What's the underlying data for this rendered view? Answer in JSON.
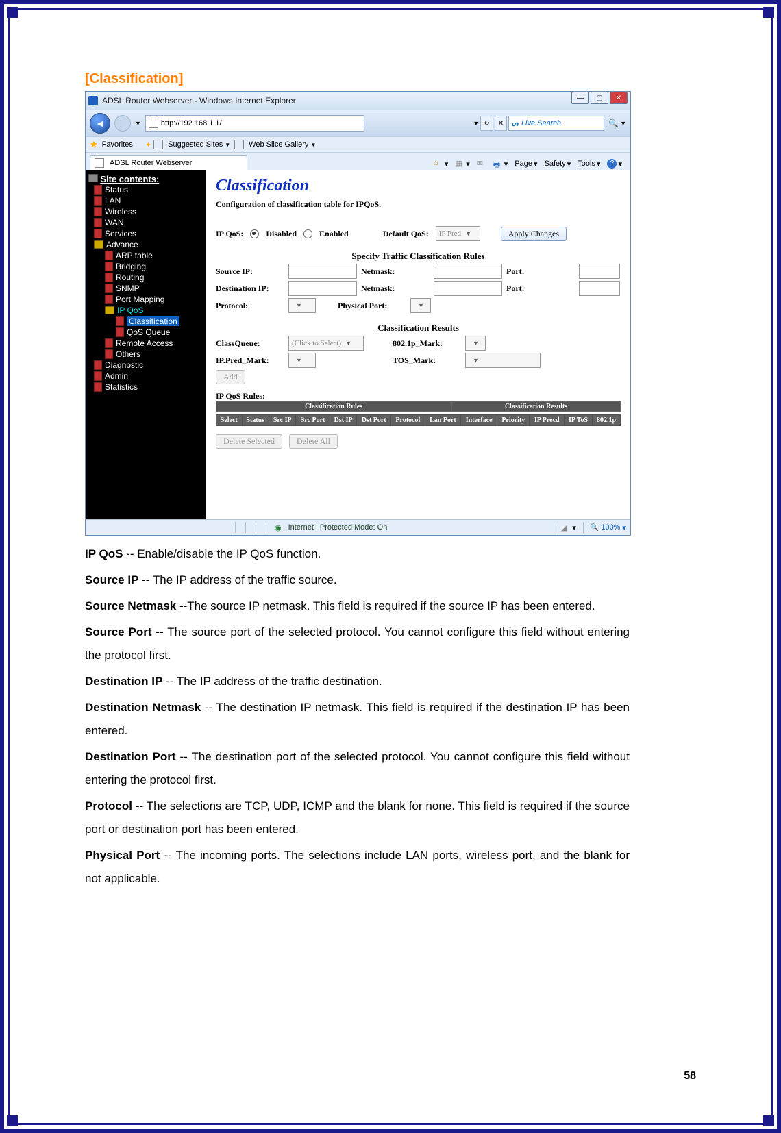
{
  "section_title": "[Classification]",
  "window": {
    "title": "ADSL Router Webserver - Windows Internet Explorer",
    "url": "http://192.168.1.1/",
    "search_placeholder": "Live Search",
    "favorites_label": "Favorites",
    "suggested_label": "Suggested Sites",
    "webslice_label": "Web Slice Gallery",
    "tab_label": "ADSL Router Webserver",
    "cmd": {
      "page": "Page",
      "safety": "Safety",
      "tools": "Tools"
    }
  },
  "sidebar": {
    "header": "Site contents:",
    "items": [
      {
        "label": "Status",
        "class": "top",
        "icon": "red"
      },
      {
        "label": "LAN",
        "class": "top",
        "icon": "red"
      },
      {
        "label": "Wireless",
        "class": "top",
        "icon": "red"
      },
      {
        "label": "WAN",
        "class": "top",
        "icon": "red"
      },
      {
        "label": "Services",
        "class": "top",
        "icon": "red"
      },
      {
        "label": "Advance",
        "class": "folder",
        "icon": "folder"
      },
      {
        "label": "ARP table",
        "class": "sub",
        "icon": "red"
      },
      {
        "label": "Bridging",
        "class": "sub",
        "icon": "red"
      },
      {
        "label": "Routing",
        "class": "sub",
        "icon": "red"
      },
      {
        "label": "SNMP",
        "class": "sub",
        "icon": "red"
      },
      {
        "label": "Port Mapping",
        "class": "sub",
        "icon": "red"
      },
      {
        "label": "IP QoS",
        "class": "qos",
        "icon": "folder"
      },
      {
        "label": "Classification",
        "class": "highlighted",
        "icon": "red"
      },
      {
        "label": "QoS Queue",
        "class": "sub2",
        "icon": "red"
      },
      {
        "label": "Remote Access",
        "class": "sub",
        "icon": "red"
      },
      {
        "label": "Others",
        "class": "sub",
        "icon": "red"
      },
      {
        "label": "Diagnostic",
        "class": "top",
        "icon": "red"
      },
      {
        "label": "Admin",
        "class": "top",
        "icon": "red"
      },
      {
        "label": "Statistics",
        "class": "top",
        "icon": "red"
      }
    ]
  },
  "panel": {
    "title": "Classification",
    "subtitle": "Configuration of classification table for IPQoS.",
    "ipqos_label": "IP QoS:",
    "disabled": "Disabled",
    "enabled": "Enabled",
    "defaultqos": "Default QoS:",
    "defaultqos_val": "IP Pred",
    "apply": "Apply Changes",
    "specify_header": "Specify Traffic Classification Rules",
    "sourceip": "Source IP:",
    "netmask": "Netmask:",
    "port": "Port:",
    "destip": "Destination IP:",
    "protocol": "Protocol:",
    "phyport": "Physical Port:",
    "results_header": "Classification Results",
    "classqueue": "ClassQueue:",
    "classqueue_val": "(Click to Select)",
    "mark802": "802.1p_Mark:",
    "ippredmark": "IP.Pred_Mark:",
    "tosmark": "TOS_Mark:",
    "add": "Add",
    "rules_label": "IP QoS Rules:",
    "hdr_class": "Classification Rules",
    "hdr_results": "Classification Results",
    "cols": [
      "Select",
      "Status",
      "Src IP",
      "Src Port",
      "Dst IP",
      "Dst Port",
      "Protocol",
      "Lan Port",
      "Interface",
      "Priority",
      "IP Precd",
      "IP ToS",
      "802.1p"
    ],
    "delete_sel": "Delete Selected",
    "delete_all": "Delete All"
  },
  "statusbar": {
    "mode": "Internet | Protected Mode: On",
    "zoom": "100%"
  },
  "desc": [
    {
      "term": "IP QoS",
      "def": " -- Enable/disable the IP QoS function."
    },
    {
      "term": "Source IP",
      "def": " -- The IP address of the traffic source."
    },
    {
      "term": "Source Netmask",
      "def": " --The source IP netmask. This field is required if the source IP has been entered."
    },
    {
      "term": "Source Port",
      "def": " -- The source port of the selected protocol. You cannot configure this field without entering the protocol first."
    },
    {
      "term": "Destination IP",
      "def": " -- The IP address of the traffic destination."
    },
    {
      "term": "Destination Netmask",
      "def": " -- The destination IP netmask. This field is required if the destination IP has been entered."
    },
    {
      "term": "Destination Port",
      "def": " -- The destination port of the selected protocol. You cannot configure this field without entering the protocol first."
    },
    {
      "term": "Protocol",
      "def": " -- The selections are TCP, UDP, ICMP and the blank for none. This field is required if the source port or destination port has been entered."
    },
    {
      "term": "Physical Port",
      "def": " -- The incoming ports. The selections include LAN ports, wireless port, and the blank for not applicable."
    }
  ],
  "page_number": "58"
}
